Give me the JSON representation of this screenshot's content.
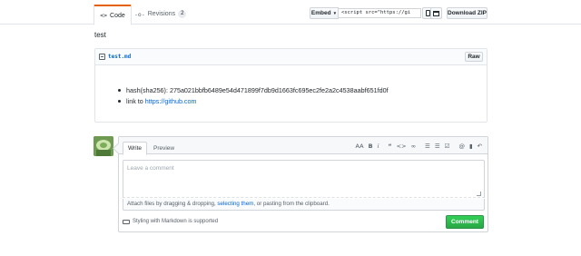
{
  "tabs": {
    "code": {
      "icon": "<>",
      "label": "Code"
    },
    "revisions": {
      "icon": "-o-",
      "label": "Revisions",
      "count": "2"
    }
  },
  "toolbar": {
    "embed_label": "Embed",
    "embed_value": "<script src=\"https://gi",
    "download_label": "Download ZIP"
  },
  "gist": {
    "description": "test",
    "file": {
      "name": "test.md",
      "raw_label": "Raw",
      "items": [
        {
          "text": "hash(sha256): 275a021bbfb6489e54d471899f7db9d1663fc695ec2fe2a2c4538aabf651fd0f"
        },
        {
          "prefix": "link to ",
          "link": "https://github.com"
        }
      ]
    }
  },
  "comment_form": {
    "write_tab": "Write",
    "preview_tab": "Preview",
    "placeholder": "Leave a comment",
    "attach": {
      "before": "Attach files by dragging & dropping, ",
      "link": "selecting them",
      "after": ", or pasting from the clipboard."
    },
    "markdown_note": "Styling with Markdown is supported",
    "submit_label": "Comment",
    "tools": {
      "heading": "AA",
      "bold": "B",
      "italic": "i",
      "quote": "“",
      "code": "<>",
      "link": "∞",
      "bulleted_list": "☰",
      "numbered_list": "☰",
      "task_list": "☑",
      "mention": "@",
      "bookmark": "▮",
      "reply": "↶"
    }
  },
  "colors": {
    "link": "#0366d6",
    "accent": "#e36209",
    "submit": "#28a745"
  }
}
